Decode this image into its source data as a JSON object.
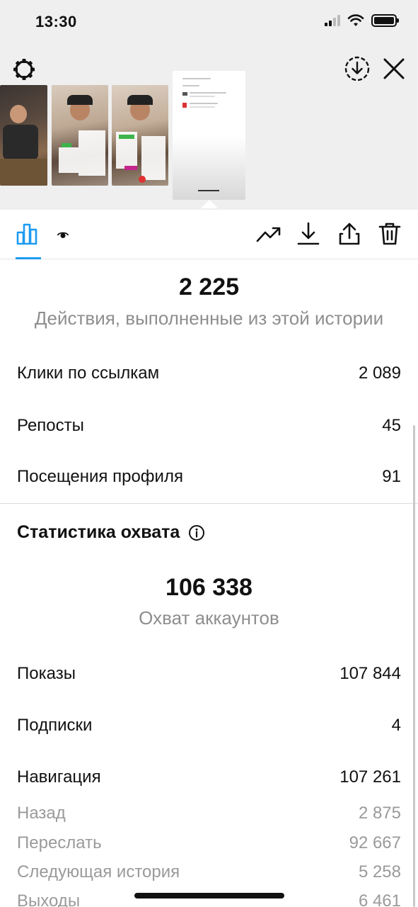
{
  "status_bar": {
    "time": "13:30"
  },
  "story_panel": {
    "icons": [
      "gear-icon",
      "download-circle-icon",
      "close-icon"
    ]
  },
  "tabs": {
    "icons": [
      "bar-chart-icon",
      "eye-icon"
    ],
    "tools": [
      "trend-icon",
      "download-icon",
      "share-icon",
      "trash-icon"
    ],
    "accent": "#1d9bf0"
  },
  "actions": {
    "total": "2 225",
    "caption": "Действия, выполненные из этой истории",
    "rows": [
      {
        "label": "Клики по ссылкам",
        "value": "2 089"
      },
      {
        "label": "Репосты",
        "value": "45"
      },
      {
        "label": "Посещения профиля",
        "value": "91"
      }
    ]
  },
  "reach": {
    "title": "Статистика охвата",
    "total": "106 338",
    "caption": "Охват аккаунтов",
    "rows": [
      {
        "label": "Показы",
        "value": "107 844"
      },
      {
        "label": "Подписки",
        "value": "4"
      },
      {
        "label": "Навигация",
        "value": "107 261"
      }
    ],
    "navigation_rows": [
      {
        "label": "Назад",
        "value": "2 875"
      },
      {
        "label": "Переслать",
        "value": "92 667"
      },
      {
        "label": "Следующая история",
        "value": "5 258"
      },
      {
        "label": "Выходы",
        "value": "6 461"
      }
    ]
  }
}
